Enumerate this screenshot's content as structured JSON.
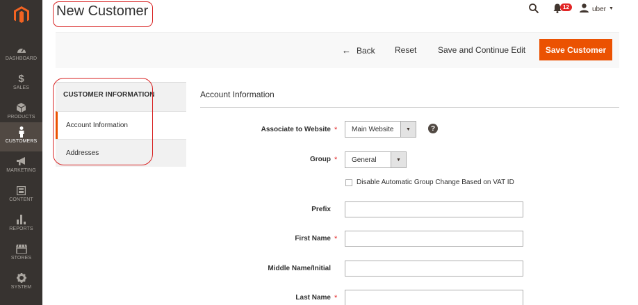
{
  "sidebar": {
    "items": [
      {
        "label": "DASHBOARD",
        "icon": "dashboard-icon"
      },
      {
        "label": "SALES",
        "icon": "dollar-icon"
      },
      {
        "label": "PRODUCTS",
        "icon": "box-icon"
      },
      {
        "label": "CUSTOMERS",
        "icon": "person-icon",
        "active": true
      },
      {
        "label": "MARKETING",
        "icon": "megaphone-icon"
      },
      {
        "label": "CONTENT",
        "icon": "layout-icon"
      },
      {
        "label": "REPORTS",
        "icon": "bar-chart-icon"
      },
      {
        "label": "STORES",
        "icon": "storefront-icon"
      },
      {
        "label": "SYSTEM",
        "icon": "gear-icon"
      }
    ]
  },
  "header": {
    "title": "New Customer",
    "notifications": "12",
    "user": "uber"
  },
  "actions": {
    "back": "Back",
    "reset": "Reset",
    "save_continue": "Save and Continue Edit",
    "save": "Save Customer"
  },
  "tabs": {
    "header": "CUSTOMER INFORMATION",
    "items": [
      {
        "label": "Account Information",
        "active": true
      },
      {
        "label": "Addresses"
      }
    ]
  },
  "form": {
    "section_title": "Account Information",
    "website": {
      "label": "Associate to Website",
      "value": "Main Website"
    },
    "group": {
      "label": "Group",
      "value": "General"
    },
    "disable_vat": {
      "label": "Disable Automatic Group Change Based on VAT ID"
    },
    "prefix": {
      "label": "Prefix",
      "value": ""
    },
    "first_name": {
      "label": "First Name",
      "value": ""
    },
    "middle_name": {
      "label": "Middle Name/Initial",
      "value": ""
    },
    "last_name": {
      "label": "Last Name",
      "value": ""
    }
  },
  "colors": {
    "accent": "#eb5202",
    "sidebar": "#373330",
    "highlight": "#d82323"
  }
}
